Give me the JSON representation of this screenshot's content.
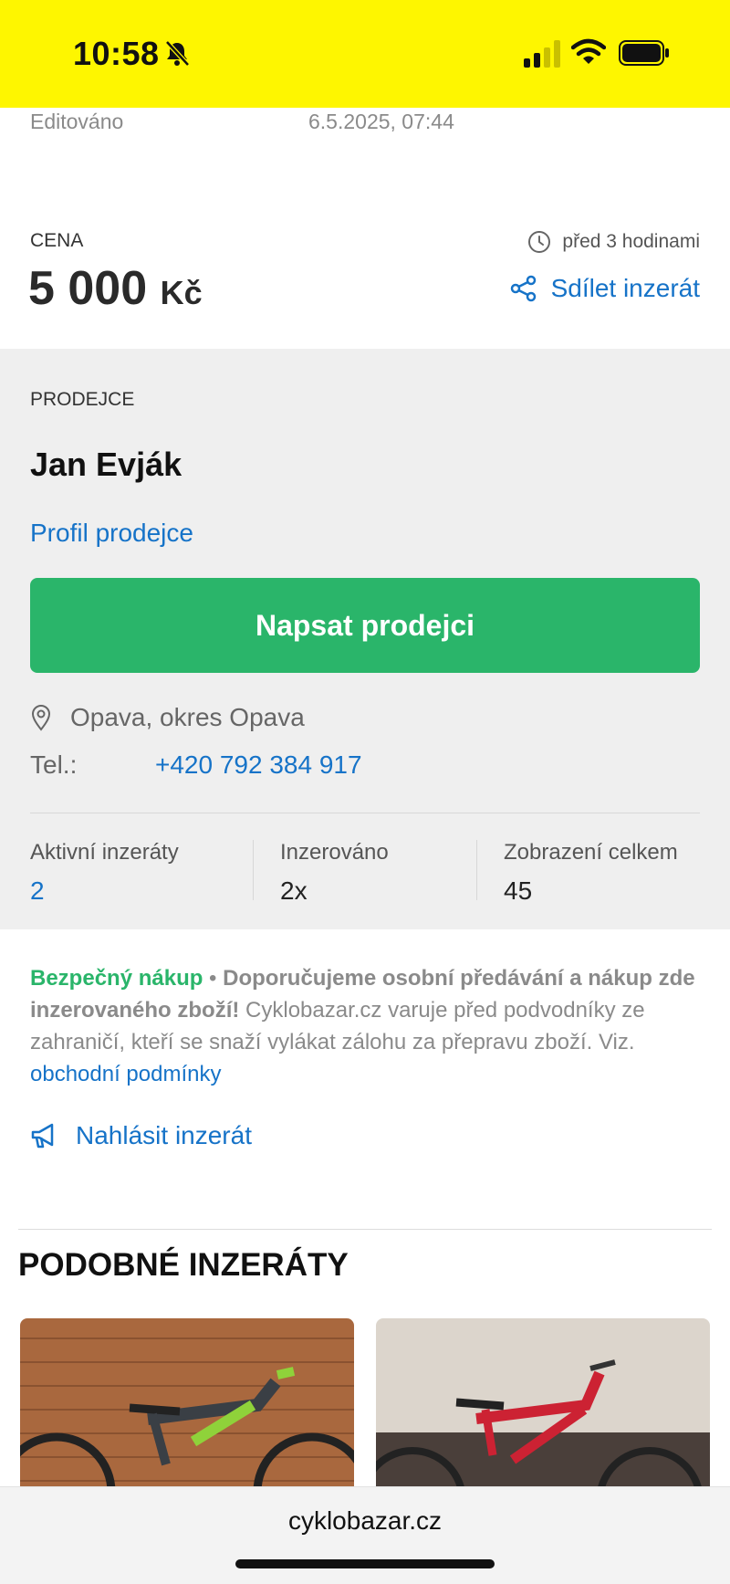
{
  "status_bar": {
    "time": "10:58"
  },
  "edited": {
    "label": "Editováno",
    "value": "6.5.2025, 07:44"
  },
  "price": {
    "label": "CENA",
    "amount": "5 000",
    "currency": "Kč",
    "posted": "před 3 hodinami",
    "share_label": "Sdílet inzerát"
  },
  "seller": {
    "section_label": "PRODEJCE",
    "name": "Jan Evják",
    "profile_link": "Profil prodejce",
    "write_button": "Napsat prodejci",
    "location": "Opava, okres Opava",
    "tel_label": "Tel.:",
    "tel_value": "+420 792 384 917",
    "stats": [
      {
        "label": "Aktivní inzeráty",
        "value": "2"
      },
      {
        "label": "Inzerováno",
        "value": "2x"
      },
      {
        "label": "Zobrazení celkem",
        "value": "45"
      }
    ]
  },
  "notice": {
    "title": "Bezpečný nákup",
    "separator": " • ",
    "bold_text": "Doporučujeme osobní předávání a nákup zde inzerovaného zboží!",
    "text": " Cyklobazar.cz varuje před podvodníky ze zahraničí, kteří se snaží vylákat zálohu za přepravu zboží. Viz. ",
    "link": "obchodní podmínky"
  },
  "report_label": "Nahlásit inzerát",
  "similar": {
    "title": "PODOBNÉ INZERÁTY"
  },
  "browser": {
    "url": "cyklobazar.cz"
  },
  "colors": {
    "status_bar": "#fef600",
    "accent_blue": "#1673c8",
    "button_green": "#2ab56a",
    "seller_bg": "#efefef"
  }
}
